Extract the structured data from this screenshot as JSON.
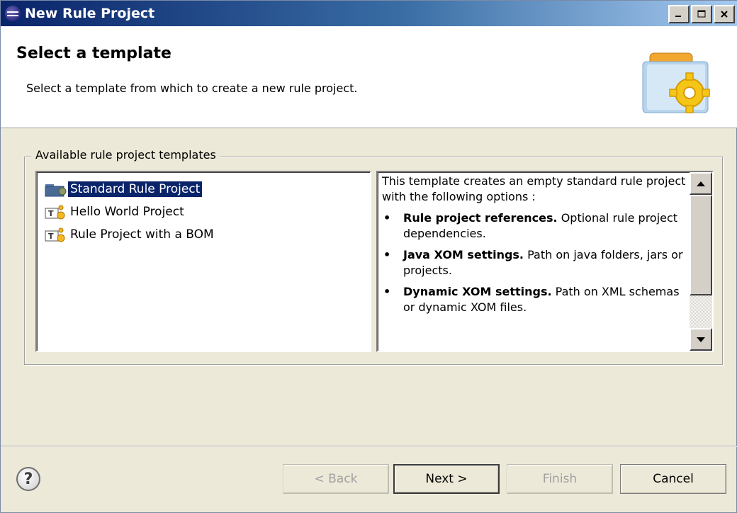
{
  "window": {
    "title": "New Rule Project",
    "controls": [
      "minimize",
      "maximize",
      "close"
    ]
  },
  "header": {
    "title": "Select a template",
    "description": "Select a template from which to create a new rule project."
  },
  "templates": {
    "group_label": "Available rule project templates",
    "items": [
      {
        "label": "Standard Rule Project",
        "selected": true,
        "icon": "rule-project-icon"
      },
      {
        "label": "Hello World Project",
        "selected": false,
        "icon": "template-project-icon"
      },
      {
        "label": "Rule Project with a BOM",
        "selected": false,
        "icon": "template-project-icon"
      }
    ]
  },
  "description": {
    "intro": "This template creates an empty standard rule project with the following options :",
    "items": [
      {
        "title": "Rule project references.",
        "text": " Optional rule project dependencies."
      },
      {
        "title": "Java XOM settings.",
        "text": " Path on java folders, jars or projects."
      },
      {
        "title": "Dynamic XOM settings.",
        "text": " Path on XML schemas or dynamic XOM files."
      }
    ],
    "bullet": "•"
  },
  "footer": {
    "help": "?",
    "back": "< Back",
    "next": "Next >",
    "finish": "Finish",
    "cancel": "Cancel"
  }
}
